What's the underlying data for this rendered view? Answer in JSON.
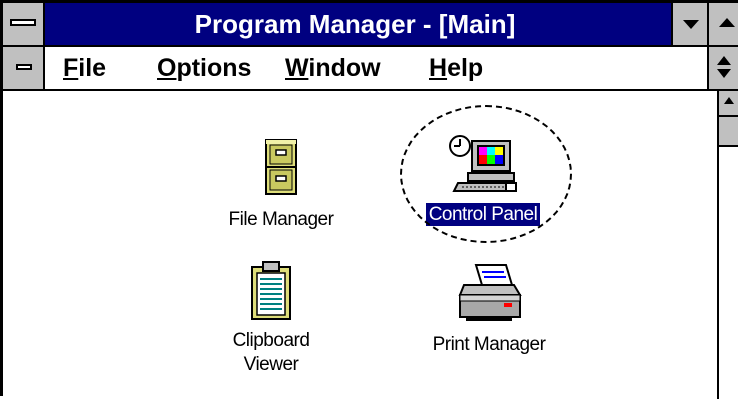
{
  "window": {
    "title": "Program Manager - [Main]"
  },
  "menu": {
    "items": [
      {
        "accel": "F",
        "rest": "ile"
      },
      {
        "accel": "O",
        "rest": "ptions"
      },
      {
        "accel": "W",
        "rest": "indow"
      },
      {
        "accel": "H",
        "rest": "elp"
      }
    ]
  },
  "icons": {
    "file_manager": "File Manager",
    "control_panel": "Control Panel",
    "clipboard_line1": "Clipboard",
    "clipboard_line2": "Viewer",
    "print_manager": "Print Manager"
  },
  "colors": {
    "titlebar": "#000080",
    "selection": "#000080",
    "chrome": "#c0c0c0"
  }
}
